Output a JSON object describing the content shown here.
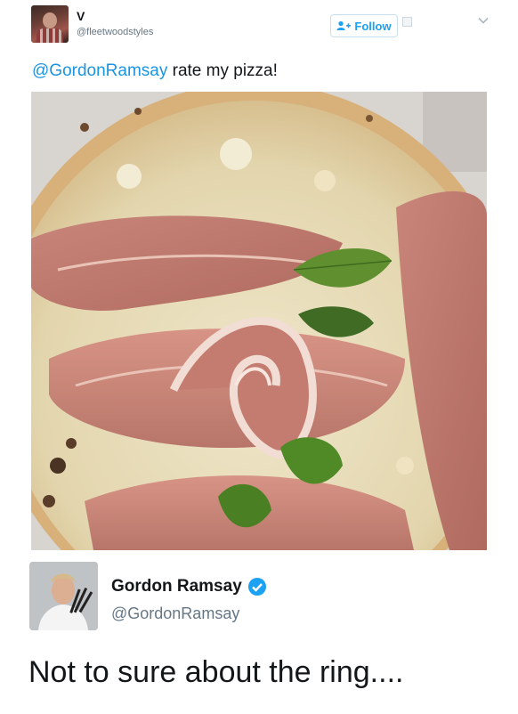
{
  "original_tweet": {
    "name": "V",
    "handle": "@fleetwoodstyles",
    "follow_label": "Follow",
    "mention": "@GordonRamsay",
    "text_rest": " rate my pizza!"
  },
  "reply": {
    "name": "Gordon Ramsay",
    "handle": "@GordonRamsay",
    "text": "Not to sure about the ring...."
  },
  "colors": {
    "link_blue": "#1b95e0",
    "verified_blue": "#1da1f2",
    "text_dark": "#14171a",
    "text_grey": "#657786"
  },
  "icons": [
    "follow-plus-icon",
    "chevron-down-icon",
    "verified-badge-icon"
  ]
}
